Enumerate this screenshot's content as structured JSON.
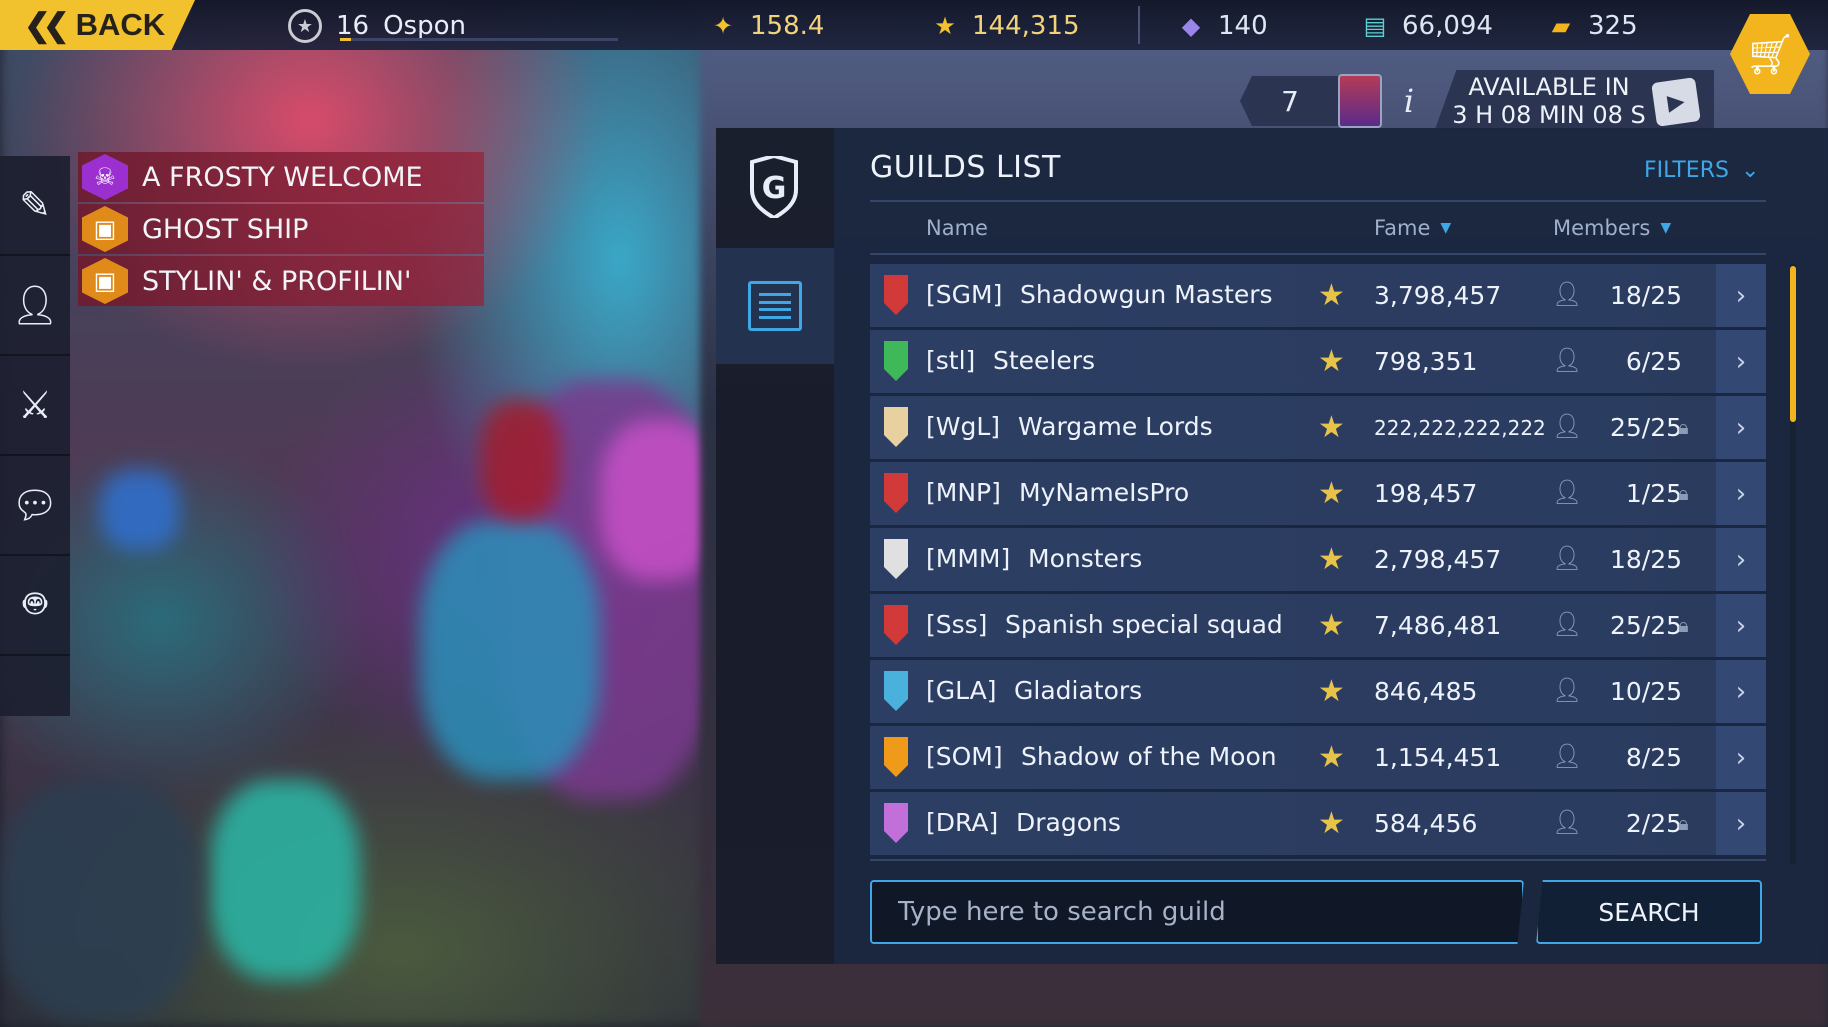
{
  "topbar": {
    "back_label": "BACK",
    "player_level": "16",
    "player_name": "Ospon",
    "player_progress": 0.04,
    "rating": "158.4",
    "fame": "144,315",
    "crystals": "140",
    "cash": "66,094",
    "gold": "325"
  },
  "offer": {
    "count": "7",
    "available_line1": "AVAILABLE IN",
    "available_line2": "3 H 08 MIN 08 S"
  },
  "quests": [
    {
      "label": "A FROSTY WELCOME",
      "icon": "skull-icon",
      "color": "#9b2fd0"
    },
    {
      "label": "GHOST SHIP",
      "icon": "crate-icon",
      "color": "#e08a1a"
    },
    {
      "label": "STYLIN' & PROFILIN'",
      "icon": "crate-icon",
      "color": "#e08a1a"
    }
  ],
  "rail": [
    "quest-log-icon",
    "friends-icon",
    "crossed-swords-icon",
    "chat-icon",
    "robot-icon"
  ],
  "panel": {
    "title": "GUILDS LIST",
    "filters_label": "FILTERS",
    "col_name": "Name",
    "col_fame": "Fame",
    "col_members": "Members"
  },
  "guilds": [
    {
      "tag": "[SGM]",
      "name": "Shadowgun Masters",
      "fame": "3,798,457",
      "members": "18/25",
      "locked": false,
      "color": "#d23a3a"
    },
    {
      "tag": "[stl]",
      "name": "Steelers",
      "fame": "798,351",
      "members": "6/25",
      "locked": false,
      "color": "#3fb85a"
    },
    {
      "tag": "[WgL]",
      "name": "Wargame Lords",
      "fame": "222,222,222,222",
      "members": "25/25",
      "locked": true,
      "color": "#e8d0a0"
    },
    {
      "tag": "[MNP]",
      "name": "MyNameIsPro",
      "fame": "198,457",
      "members": "1/25",
      "locked": true,
      "color": "#d23a3a"
    },
    {
      "tag": "[MMM]",
      "name": "Monsters",
      "fame": "2,798,457",
      "members": "18/25",
      "locked": false,
      "color": "#e0e0e0"
    },
    {
      "tag": "[Sss]",
      "name": "Spanish special squad",
      "fame": "7,486,481",
      "members": "25/25",
      "locked": true,
      "color": "#d23a3a"
    },
    {
      "tag": "[GLA]",
      "name": "Gladiators",
      "fame": "846,485",
      "members": "10/25",
      "locked": false,
      "color": "#4ab0dc"
    },
    {
      "tag": "[SOM]",
      "name": "Shadow of the Moon",
      "fame": "1,154,451",
      "members": "8/25",
      "locked": false,
      "color": "#f09a1a"
    },
    {
      "tag": "[DRA]",
      "name": "Dragons",
      "fame": "584,456",
      "members": "2/25",
      "locked": true,
      "color": "#c070d8"
    }
  ],
  "search": {
    "placeholder": "Type here to search guild",
    "button_label": "SEARCH"
  }
}
